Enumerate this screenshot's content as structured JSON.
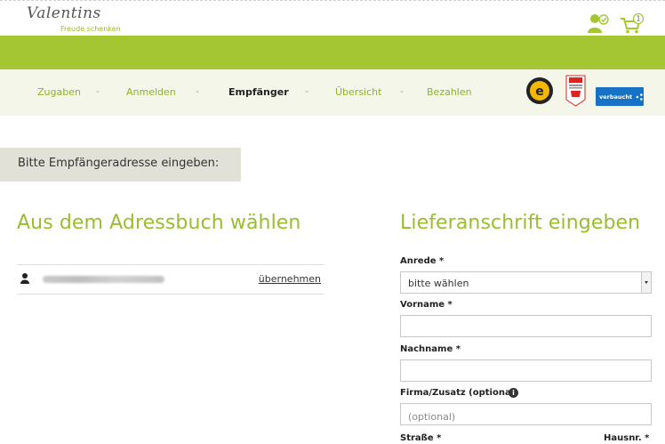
{
  "header": {
    "logo_script": "Valentins",
    "logo_tagline": "Freude schenken",
    "cart_count": "1",
    "icons": [
      "account-check-icon",
      "cart-icon"
    ]
  },
  "steps": [
    {
      "label": "Zugaben",
      "active": false
    },
    {
      "label": "Anmelden",
      "active": false
    },
    {
      "label": "Empfänger",
      "active": true
    },
    {
      "label": "Übersicht",
      "active": false
    },
    {
      "label": "Bezahlen",
      "active": false
    }
  ],
  "step_separator": "-",
  "trust_badges": {
    "verbu_label": "verbaucht"
  },
  "prompt": "Bitte Empfängeradresse eingeben:",
  "address_book": {
    "heading": "Aus dem Adressbuch wählen",
    "adopt_label": "übernehmen"
  },
  "delivery_form": {
    "heading": "Lieferanschrift eingeben",
    "salutation_label": "Anrede *",
    "salutation_value": "bitte wählen",
    "firstname_label": "Vorname *",
    "lastname_label": "Nachname *",
    "company_label": "Firma/Zusatz (optional)",
    "company_placeholder": "(optional)",
    "street_label": "Straße *",
    "housenr_label": "Hausnr. *"
  },
  "colors": {
    "brand_green": "#a3c632",
    "heading_green": "#99bd2f",
    "step_green": "#8fb22a"
  }
}
